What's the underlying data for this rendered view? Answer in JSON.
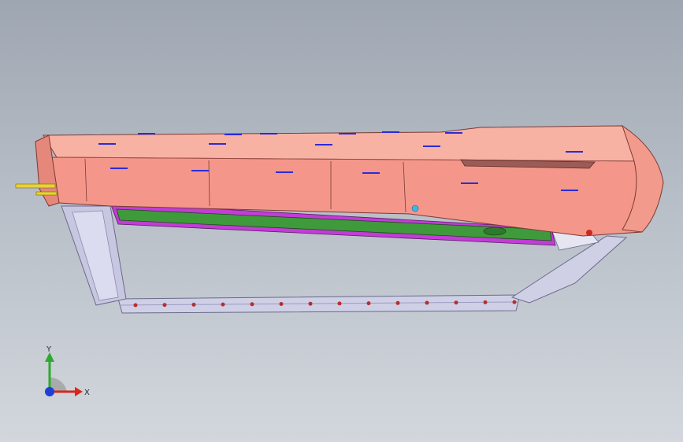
{
  "viewport": {
    "background_top": "#9ea6b1",
    "background_bottom": "#d3d7dd"
  },
  "model": {
    "body_color": "#f4978a",
    "body_light": "#f8b2a4",
    "edge_color": "#7a3a35",
    "frame_color": "#cfcfe6",
    "frame_shade": "#9c9cc4",
    "board_green": "#3f9a3c",
    "board_magenta": "#c23cd6",
    "mark_color": "#2b2bd8",
    "hole_color": "#b5302a",
    "pin_color": "#e8d23a"
  },
  "triad": {
    "x_label": "X",
    "y_label": "Y",
    "x_color": "#d8261c",
    "y_color": "#2ea82e",
    "z_color": "#1f3fd6"
  }
}
